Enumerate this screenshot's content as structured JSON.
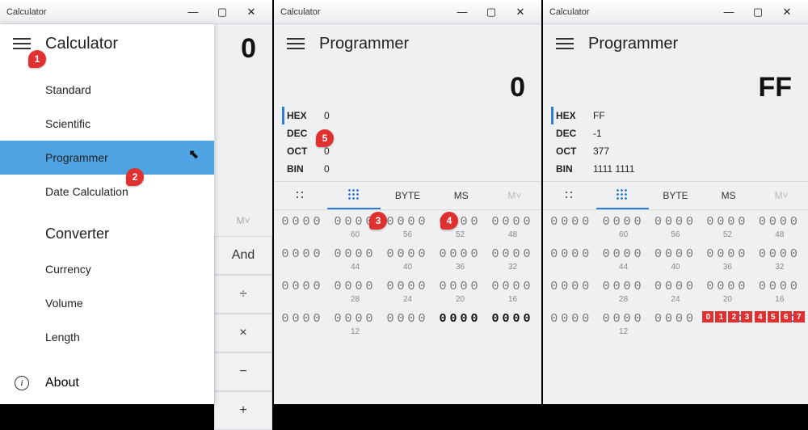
{
  "title": "Calculator",
  "win": {
    "min": "—",
    "max": "▢",
    "close": "✕"
  },
  "panel1": {
    "mode": "Calculator",
    "display": "0",
    "menu": {
      "items": [
        "Standard",
        "Scientific",
        "Programmer",
        "Date Calculation"
      ],
      "selected": "Programmer",
      "group2_label": "Converter",
      "group2_items": [
        "Currency",
        "Volume",
        "Length"
      ],
      "about": "About"
    },
    "mem_label": "M˅",
    "ops": [
      "And",
      "÷",
      "×",
      "−",
      "+"
    ],
    "badges": {
      "b1": "1",
      "b2": "2"
    }
  },
  "panel2": {
    "mode": "Programmer",
    "display": "0",
    "bases": [
      {
        "label": "HEX",
        "value": "0",
        "active": true
      },
      {
        "label": "DEC",
        "value": "0"
      },
      {
        "label": "OCT",
        "value": "0"
      },
      {
        "label": "BIN",
        "value": "0"
      }
    ],
    "toggles": {
      "byte": "BYTE",
      "ms": "MS",
      "mem": "M˅"
    },
    "bitrows": [
      [
        {
          "bits": "0000",
          "idx": ""
        },
        {
          "bits": "0000",
          "idx": "60"
        },
        {
          "bits": "0000",
          "idx": "56"
        },
        {
          "bits": "0000",
          "idx": "52"
        },
        {
          "bits": "0000",
          "idx": "48"
        }
      ],
      [
        {
          "bits": "0000",
          "idx": ""
        },
        {
          "bits": "0000",
          "idx": "44"
        },
        {
          "bits": "0000",
          "idx": "40"
        },
        {
          "bits": "0000",
          "idx": "36"
        },
        {
          "bits": "0000",
          "idx": "32"
        }
      ],
      [
        {
          "bits": "0000",
          "idx": ""
        },
        {
          "bits": "0000",
          "idx": "28"
        },
        {
          "bits": "0000",
          "idx": "24"
        },
        {
          "bits": "0000",
          "idx": "20"
        },
        {
          "bits": "0000",
          "idx": "16"
        }
      ],
      [
        {
          "bits": "0000",
          "idx": ""
        },
        {
          "bits": "0000",
          "idx": "12"
        },
        {
          "bits": "0000",
          "idx": ""
        },
        {
          "bits": "0000",
          "idx": "",
          "bold": true
        },
        {
          "bits": "0000",
          "idx": "",
          "bold": true
        }
      ]
    ],
    "badges": {
      "b3": "3",
      "b4": "4",
      "b5": "5"
    }
  },
  "panel3": {
    "mode": "Programmer",
    "display": "FF",
    "bases": [
      {
        "label": "HEX",
        "value": "FF",
        "active": true
      },
      {
        "label": "DEC",
        "value": "-1"
      },
      {
        "label": "OCT",
        "value": "377"
      },
      {
        "label": "BIN",
        "value": "1111 1111"
      }
    ],
    "toggles": {
      "byte": "BYTE",
      "ms": "MS",
      "mem": "M˅"
    },
    "bitrows": [
      [
        {
          "bits": "0000",
          "idx": ""
        },
        {
          "bits": "0000",
          "idx": "60"
        },
        {
          "bits": "0000",
          "idx": "56"
        },
        {
          "bits": "0000",
          "idx": "52"
        },
        {
          "bits": "0000",
          "idx": "48"
        }
      ],
      [
        {
          "bits": "0000",
          "idx": ""
        },
        {
          "bits": "0000",
          "idx": "44"
        },
        {
          "bits": "0000",
          "idx": "40"
        },
        {
          "bits": "0000",
          "idx": "36"
        },
        {
          "bits": "0000",
          "idx": "32"
        }
      ],
      [
        {
          "bits": "0000",
          "idx": ""
        },
        {
          "bits": "0000",
          "idx": "28"
        },
        {
          "bits": "0000",
          "idx": "24"
        },
        {
          "bits": "0000",
          "idx": "20"
        },
        {
          "bits": "0000",
          "idx": "16"
        }
      ],
      [
        {
          "bits": "0000",
          "idx": ""
        },
        {
          "bits": "0000",
          "idx": "12"
        },
        {
          "bits": "0000",
          "idx": ""
        },
        {
          "bits": "1111",
          "idx": "",
          "active": true,
          "hi": [
            "0",
            "1",
            "2",
            "3"
          ]
        },
        {
          "bits": "1111",
          "idx": "",
          "active": true,
          "hi": [
            "4",
            "5",
            "6",
            "7"
          ]
        }
      ]
    ]
  }
}
